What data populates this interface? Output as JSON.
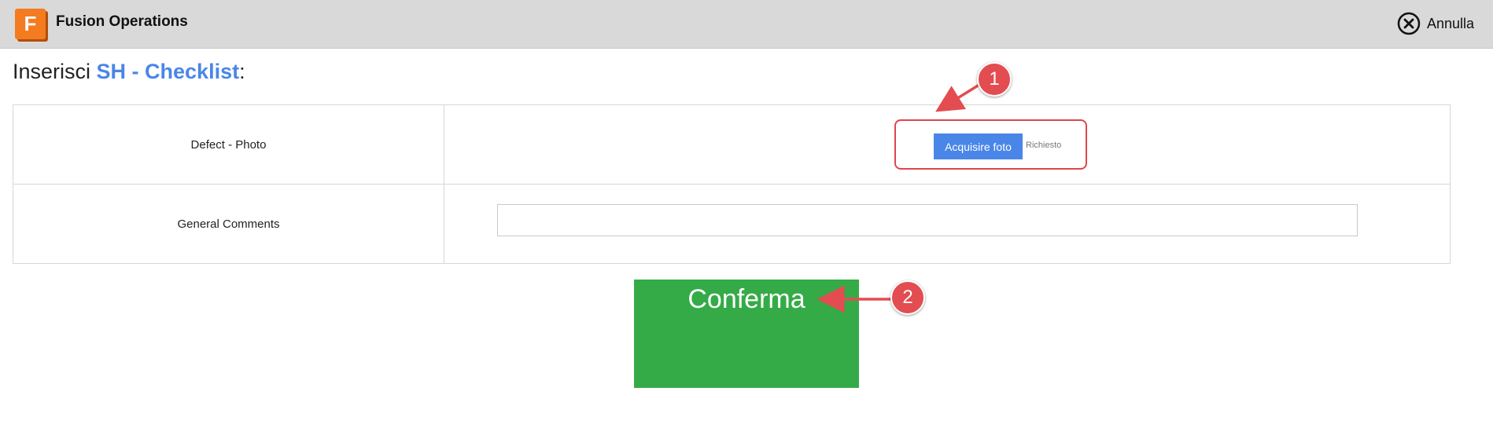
{
  "app": {
    "title": "Fusion Operations",
    "logo_letter": "F",
    "brand_color": "#f47b20"
  },
  "topbar": {
    "cancel_label": "Annulla",
    "cancel_icon": "close-circle-icon"
  },
  "heading": {
    "prefix": "Inserisci ",
    "entity": "SH - Checklist",
    "suffix": ":"
  },
  "form": {
    "rows": [
      {
        "label": "Defect - Photo",
        "button_label": "Acquisire foto",
        "required_text": "Richiesto"
      },
      {
        "label": "General Comments",
        "value": ""
      }
    ]
  },
  "confirm": {
    "label": "Conferma",
    "color": "#34ab47"
  },
  "annotations": [
    {
      "number": "1"
    },
    {
      "number": "2"
    }
  ],
  "colors": {
    "accent_blue": "#4a86e8",
    "annotation_red": "#e34c50"
  }
}
